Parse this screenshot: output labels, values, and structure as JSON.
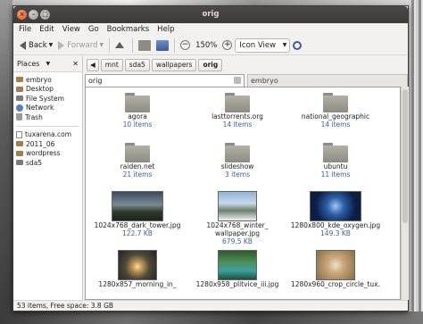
{
  "window": {
    "title": "orig"
  },
  "menu": [
    "File",
    "Edit",
    "View",
    "Go",
    "Bookmarks",
    "Help"
  ],
  "toolbar": {
    "back": "Back",
    "forward": "Forward",
    "zoom": "150%",
    "view_mode": "Icon View"
  },
  "sidebar": {
    "header": "Places",
    "places": [
      {
        "label": "embryo",
        "icon": "folder-icon"
      },
      {
        "label": "Desktop",
        "icon": "folder-icon"
      },
      {
        "label": "File System",
        "icon": "drive-icon"
      },
      {
        "label": "Network",
        "icon": "network-icon"
      },
      {
        "label": "Trash",
        "icon": "trash-icon"
      }
    ],
    "bookmarks": [
      {
        "label": "tuxarena.com",
        "icon": "document-icon"
      },
      {
        "label": "2011_06",
        "icon": "folder-icon"
      },
      {
        "label": "wordpress",
        "icon": "folder-icon"
      },
      {
        "label": "sda5",
        "icon": "drive-icon"
      }
    ]
  },
  "pathbar": [
    "mnt",
    "sda5",
    "wallpapers",
    "orig"
  ],
  "panes": {
    "left_title": "orig",
    "right_title": "embryo"
  },
  "items": [
    {
      "name": "agora",
      "sub": "10 items",
      "kind": "folder"
    },
    {
      "name": "lasttorrents.org",
      "sub": "14 items",
      "kind": "folder"
    },
    {
      "name": "national_geographic",
      "sub": "14 items",
      "kind": "folder"
    },
    {
      "name": "raiden.net",
      "sub": "21 items",
      "kind": "folder"
    },
    {
      "name": "slideshow",
      "sub": "3 items",
      "kind": "folder"
    },
    {
      "name": "ubuntu",
      "sub": "11 items",
      "kind": "folder"
    },
    {
      "name": "1024x768_dark_tower.jpg",
      "sub": "122.7 KB",
      "kind": "image"
    },
    {
      "name": "1024x768_winter_\nwallpaper.jpg",
      "sub": "679.5 KB",
      "kind": "image"
    },
    {
      "name": "1280x800_kde_oxygen.jpg",
      "sub": "149.3 KB",
      "kind": "image"
    },
    {
      "name": "1280x857_morning_in_",
      "sub": "",
      "kind": "image"
    },
    {
      "name": "1280x958_plitvice_iii.jpg",
      "sub": "",
      "kind": "image"
    },
    {
      "name": "1280x960_crop_circle_tux.",
      "sub": "",
      "kind": "image"
    }
  ],
  "status": "53 items, Free space: 3.8 GB",
  "colors": {
    "titlebar": "#3c3b37",
    "close_button": "#df4a16",
    "link_blue": "#3b5ea6"
  }
}
